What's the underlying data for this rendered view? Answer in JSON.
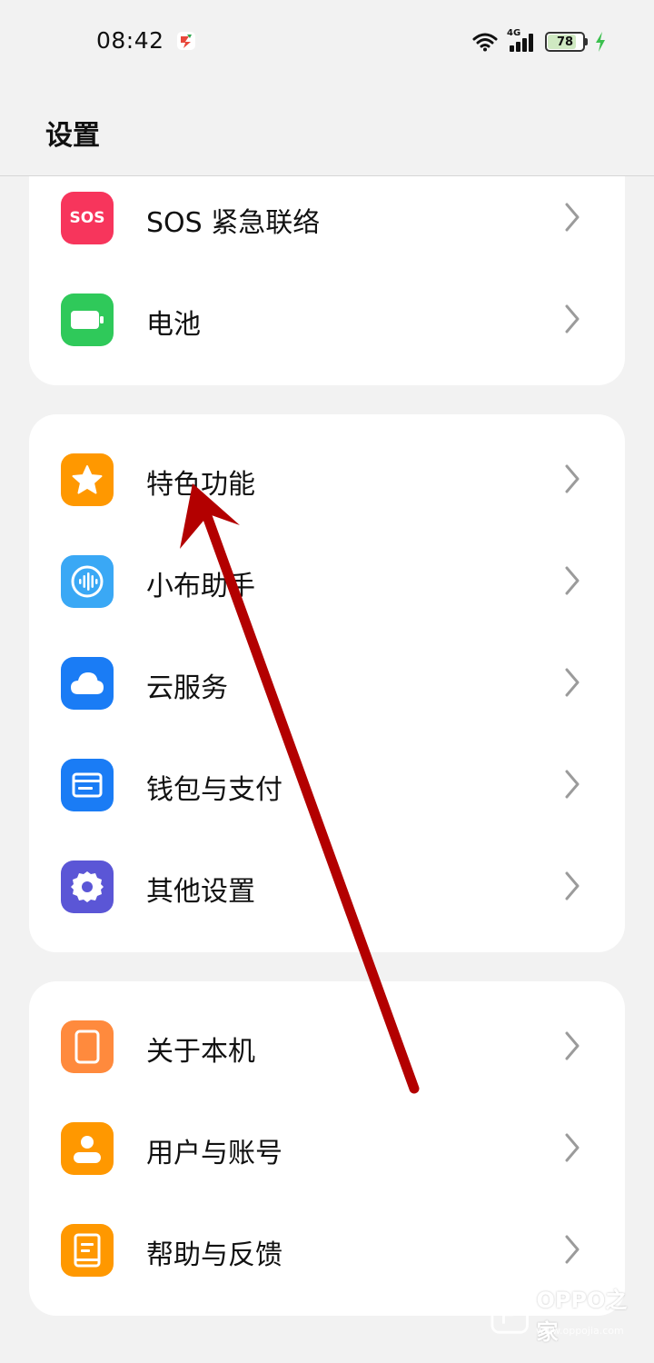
{
  "status_bar": {
    "time": "08:42",
    "network": "4G",
    "battery": "78",
    "battery_level": 0.78
  },
  "header": {
    "title": "设置"
  },
  "groups": [
    {
      "items": [
        {
          "label": "SOS 紧急联络",
          "icon": "sos-icon",
          "icon_text": "SOS",
          "color": "#f7355c"
        },
        {
          "label": "电池",
          "icon": "battery-icon",
          "color": "#2fc95a"
        }
      ]
    },
    {
      "items": [
        {
          "label": "特色功能",
          "icon": "star-icon",
          "color": "#ff9800"
        },
        {
          "label": "小布助手",
          "icon": "voice-assistant-icon",
          "color": "#3aa8f5"
        },
        {
          "label": "云服务",
          "icon": "cloud-icon",
          "color": "#1a7cf5"
        },
        {
          "label": "钱包与支付",
          "icon": "wallet-icon",
          "color": "#1a7cf5"
        },
        {
          "label": "其他设置",
          "icon": "gear-icon",
          "color": "#5b56d6"
        }
      ]
    },
    {
      "items": [
        {
          "label": "关于本机",
          "icon": "phone-icon",
          "color": "#ff8a3d"
        },
        {
          "label": "用户与账号",
          "icon": "user-icon",
          "color": "#ff9800"
        },
        {
          "label": "帮助与反馈",
          "icon": "help-book-icon",
          "color": "#ff9800"
        }
      ]
    }
  ],
  "annotation": {
    "arrow_color": "#b30000"
  },
  "watermark": {
    "text": "OPPO之家",
    "sub": "www.oppojia.com"
  }
}
